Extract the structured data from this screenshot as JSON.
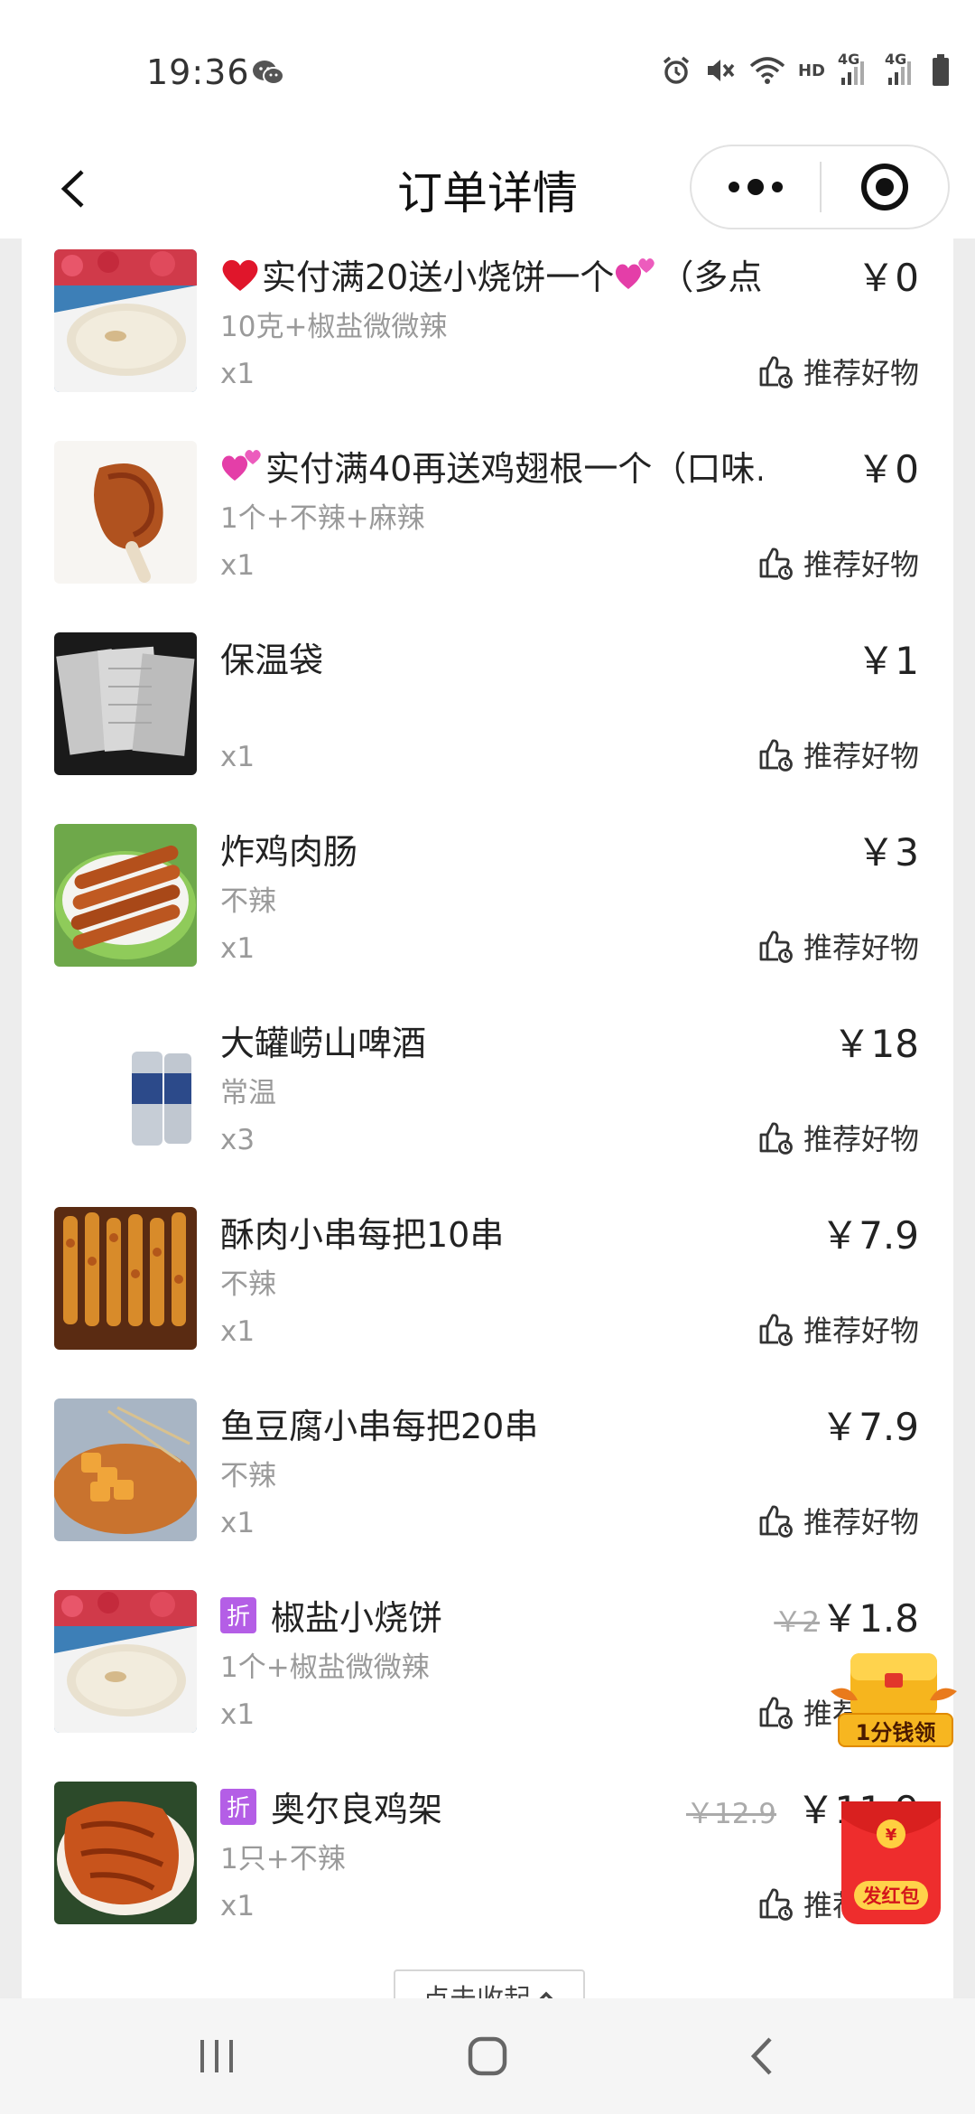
{
  "status_bar": {
    "time": "19:36",
    "hd_label": "HD",
    "signal_label_1": "4G",
    "signal_label_2": "4G",
    "icons": [
      "wechat-icon",
      "alarm-icon",
      "vibrate-mute-icon",
      "wifi-icon",
      "signal-icon",
      "signal-icon",
      "battery-icon"
    ]
  },
  "nav": {
    "title": "订单详情",
    "back_icon": "chevron-left-icon",
    "more_icon": "more-dots-icon",
    "close_icon": "target-close-icon"
  },
  "items": [
    {
      "name": "实付满20送小烧饼一个",
      "name_suffix": "（多点…",
      "lead_emoji": "heart",
      "tail_emoji": "hearts",
      "spec": "10克+椒盐微微辣",
      "qty": "x1",
      "price": "￥0",
      "original_price": "",
      "discount_tag": "",
      "recommend": "推荐好物",
      "thumb": "flatbread"
    },
    {
      "name": "实付满40再送鸡翅根一个",
      "name_suffix": "（口味…",
      "lead_emoji": "hearts",
      "tail_emoji": "",
      "spec": "1个+不辣+麻辣",
      "qty": "x1",
      "price": "￥0",
      "original_price": "",
      "discount_tag": "",
      "recommend": "推荐好物",
      "thumb": "chicken-wing"
    },
    {
      "name": "保温袋",
      "name_suffix": "",
      "lead_emoji": "",
      "tail_emoji": "",
      "spec": "",
      "qty": "x1",
      "price": "￥1",
      "original_price": "",
      "discount_tag": "",
      "recommend": "推荐好物",
      "thumb": "thermal-bag"
    },
    {
      "name": "炸鸡肉肠",
      "name_suffix": "",
      "lead_emoji": "",
      "tail_emoji": "",
      "spec": "不辣",
      "qty": "x1",
      "price": "￥3",
      "original_price": "",
      "discount_tag": "",
      "recommend": "推荐好物",
      "thumb": "sausage-skewers"
    },
    {
      "name": "大罐崂山啤酒",
      "name_suffix": "",
      "lead_emoji": "",
      "tail_emoji": "",
      "spec": "常温",
      "qty": "x3",
      "price": "￥18",
      "original_price": "",
      "discount_tag": "",
      "recommend": "推荐好物",
      "thumb": "beer-cans"
    },
    {
      "name": "酥肉小串每把10串",
      "name_suffix": "",
      "lead_emoji": "",
      "tail_emoji": "",
      "spec": "不辣",
      "qty": "x1",
      "price": "￥7.9",
      "original_price": "",
      "discount_tag": "",
      "recommend": "推荐好物",
      "thumb": "pork-skewers"
    },
    {
      "name": "鱼豆腐小串每把20串",
      "name_suffix": "",
      "lead_emoji": "",
      "tail_emoji": "",
      "spec": "不辣",
      "qty": "x1",
      "price": "￥7.9",
      "original_price": "",
      "discount_tag": "",
      "recommend": "推荐好物",
      "thumb": "fish-tofu-skewers"
    },
    {
      "name": "椒盐小烧饼",
      "name_suffix": "",
      "lead_emoji": "",
      "tail_emoji": "",
      "spec": "1个+椒盐微微辣",
      "qty": "x1",
      "price": "￥1.8",
      "original_price": "￥2",
      "discount_tag": "折",
      "recommend": "推荐好物",
      "thumb": "flatbread"
    },
    {
      "name": "奥尔良鸡架",
      "name_suffix": "",
      "lead_emoji": "",
      "tail_emoji": "",
      "spec": "1只+不辣",
      "qty": "x1",
      "price": "￥11.9",
      "original_price": "￥12.9",
      "discount_tag": "折",
      "recommend": "推荐好物",
      "thumb": "chicken-rack"
    }
  ],
  "collapse_label": "点击收起",
  "float_coin_label": "1分钱领",
  "float_redpacket_label": "发红包",
  "system_nav": {
    "recents_icon": "recents-icon",
    "home_icon": "home-icon",
    "back_icon": "back-icon"
  }
}
